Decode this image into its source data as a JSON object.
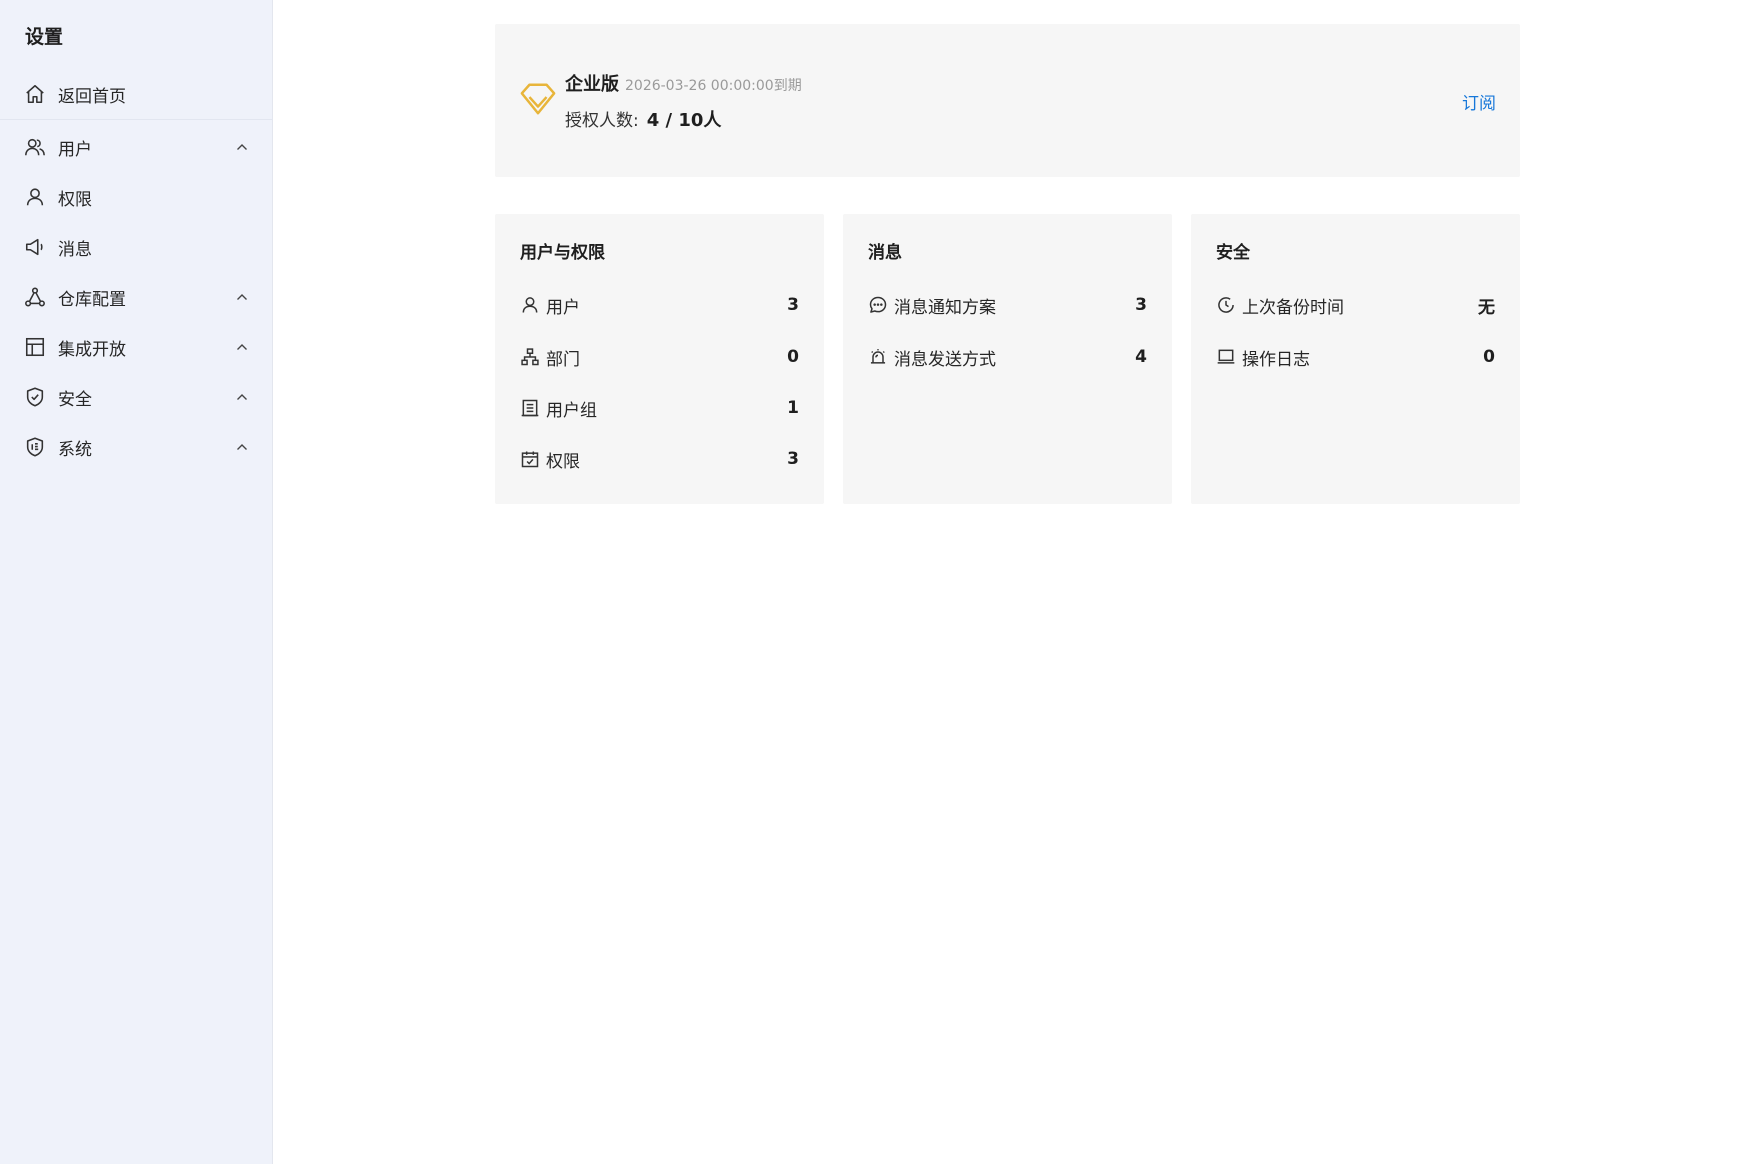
{
  "sidebar": {
    "title": "设置",
    "items": [
      {
        "label": "返回首页",
        "icon": "home-icon",
        "expandable": false
      },
      {
        "label": "用户",
        "icon": "users-icon",
        "expandable": true
      },
      {
        "label": "权限",
        "icon": "user-icon",
        "expandable": false
      },
      {
        "label": "消息",
        "icon": "megaphone-icon",
        "expandable": false
      },
      {
        "label": "仓库配置",
        "icon": "nodes-icon",
        "expandable": true
      },
      {
        "label": "集成开放",
        "icon": "layout-icon",
        "expandable": true
      },
      {
        "label": "安全",
        "icon": "shield-check-icon",
        "expandable": true
      },
      {
        "label": "系统",
        "icon": "shield-badge-icon",
        "expandable": true
      }
    ]
  },
  "license": {
    "edition": "企业版",
    "expiry": "2026-03-26 00:00:00到期",
    "seats_label": "授权人数:",
    "seats_value": "4 / 10人",
    "subscribe_label": "订阅",
    "icon": "diamond-icon",
    "accent_color": "#e8b53a"
  },
  "cards": [
    {
      "title": "用户与权限",
      "rows": [
        {
          "icon": "user-icon",
          "label": "用户",
          "value": "3"
        },
        {
          "icon": "org-chart-icon",
          "label": "部门",
          "value": "0"
        },
        {
          "icon": "building-icon",
          "label": "用户组",
          "value": "1"
        },
        {
          "icon": "calendar-check-icon",
          "label": "权限",
          "value": "3"
        }
      ]
    },
    {
      "title": "消息",
      "rows": [
        {
          "icon": "chat-bubble-icon",
          "label": "消息通知方案",
          "value": "3"
        },
        {
          "icon": "alarm-icon",
          "label": "消息发送方式",
          "value": "4"
        }
      ]
    },
    {
      "title": "安全",
      "rows": [
        {
          "icon": "clock-icon",
          "label": "上次备份时间",
          "value": "无"
        },
        {
          "icon": "laptop-icon",
          "label": "操作日志",
          "value": "0"
        }
      ]
    }
  ],
  "colors": {
    "sidebar_bg": "#eff2fa",
    "card_bg": "#f6f6f6",
    "link": "#1677d9"
  }
}
